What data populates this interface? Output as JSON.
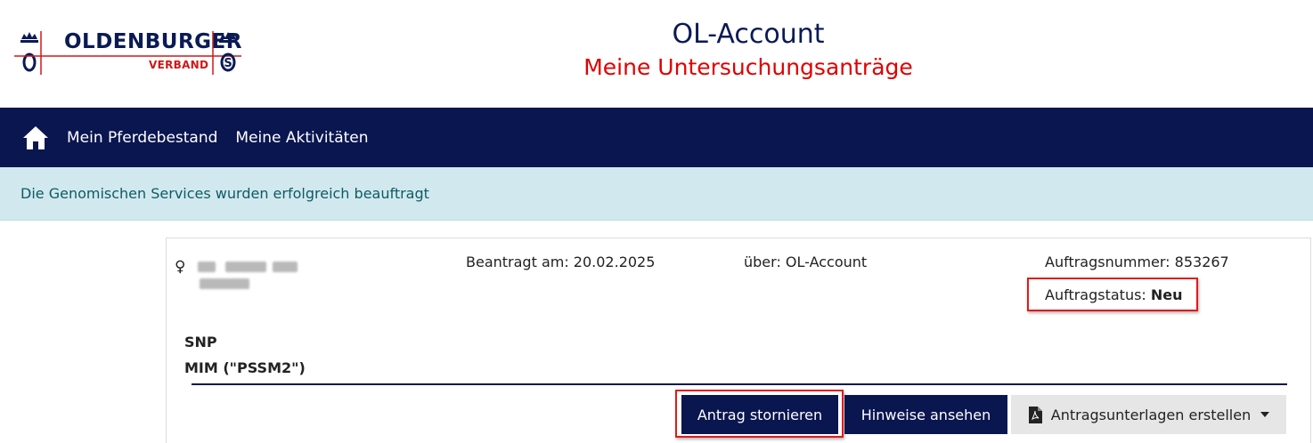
{
  "header": {
    "logo_main": "OLDENBURGER",
    "logo_sub": "VERBAND",
    "title": "OL-Account",
    "subtitle": "Meine Untersuchungsanträge"
  },
  "nav": {
    "items": [
      {
        "label": "Mein Pferdebestand"
      },
      {
        "label": "Meine Aktivitäten"
      }
    ]
  },
  "alert": {
    "message": "Die Genomischen Services wurden erfolgreich beauftragt"
  },
  "request": {
    "sex_symbol": "♀",
    "requested_on": "Beantragt am: 20.02.2025",
    "via": "über: OL-Account",
    "order_number": "Auftragsnummer: 853267",
    "status_label": "Auftragstatus: ",
    "status_value": "Neu",
    "services": [
      "SNP",
      "MIM (\"PSSM2\")"
    ]
  },
  "actions": {
    "cancel": "Antrag stornieren",
    "hints": "Hinweise ansehen",
    "documents": "Antragsunterlagen erstellen"
  },
  "colors": {
    "brand_navy": "#0a1650",
    "brand_red": "#e00000",
    "alert_bg": "#d1e9ee",
    "alert_text": "#0e5a66",
    "highlight_red": "#e21a1a"
  },
  "icons": {
    "home": "home-icon",
    "sex": "female-icon",
    "pdf": "pdf-file-icon",
    "caret": "caret-down-icon"
  }
}
